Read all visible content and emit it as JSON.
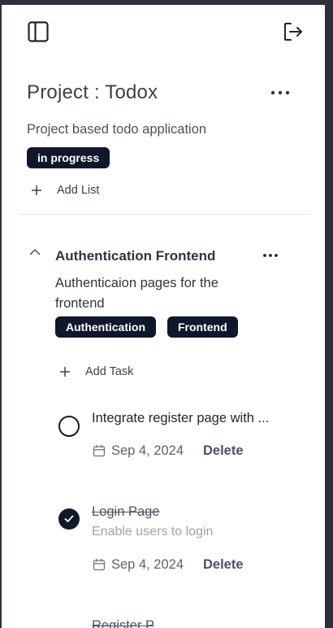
{
  "header": {
    "sidebar_toggle_icon": "sidebar-panel-icon",
    "logout_icon": "logout-arrow-icon"
  },
  "project": {
    "title": "Project : Todox",
    "description": "Project based todo application",
    "status": "in progress",
    "add_list_label": "Add List",
    "more_icon": "more-horizontal-icon"
  },
  "list": {
    "title": "Authentication Frontend",
    "description": "Authenticaion pages for the frontend",
    "tags": [
      "Authentication",
      "Frontend"
    ],
    "add_task_label": "Add Task",
    "collapse_icon": "chevron-up-icon"
  },
  "tasks": [
    {
      "title": "Integrate register page with ...",
      "description": "",
      "date": "Sep 4, 2024",
      "delete_label": "Delete",
      "completed": false
    },
    {
      "title": "Login Page",
      "description": "Enable users to login",
      "date": "Sep 4, 2024",
      "delete_label": "Delete",
      "completed": true
    },
    {
      "title": "Register P",
      "description": "",
      "date": "",
      "delete_label": "",
      "completed": false
    }
  ],
  "colors": {
    "badge_bg": "#0f172a",
    "badge_text": "#ffffff",
    "check_done": "#111827"
  }
}
